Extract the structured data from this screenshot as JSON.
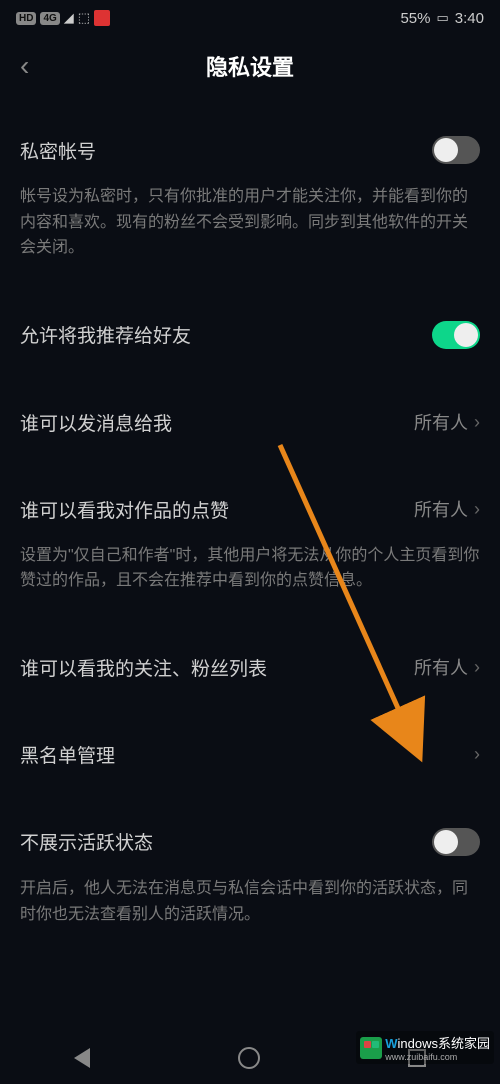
{
  "statusbar": {
    "hd": "HD",
    "signal": "4G",
    "battery_pct": "55%",
    "time": "3:40"
  },
  "header": {
    "title": "隐私设置"
  },
  "items": {
    "private_account": {
      "label": "私密帐号",
      "on": false,
      "desc": "帐号设为私密时，只有你批准的用户才能关注你，并能看到你的内容和喜欢。现有的粉丝不会受到影响。同步到其他软件的开关会关闭。"
    },
    "recommend_friends": {
      "label": "允许将我推荐给好友",
      "on": true
    },
    "who_msg": {
      "label": "谁可以发消息给我",
      "value": "所有人"
    },
    "who_likes": {
      "label": "谁可以看我对作品的点赞",
      "value": "所有人",
      "desc": "设置为\"仅自己和作者\"时，其他用户将无法从你的个人主页看到你赞过的作品，且不会在推荐中看到你的点赞信息。"
    },
    "who_follow": {
      "label": "谁可以看我的关注、粉丝列表",
      "value": "所有人"
    },
    "blocklist": {
      "label": "黑名单管理"
    },
    "hide_active": {
      "label": "不展示活跃状态",
      "on": false,
      "desc": "开启后，他人无法在消息页与私信会话中看到你的活跃状态，同时你也无法查看别人的活跃情况。"
    }
  },
  "watermark": {
    "main": "indows系统家园",
    "sub": "www.zuibaifu.com"
  }
}
